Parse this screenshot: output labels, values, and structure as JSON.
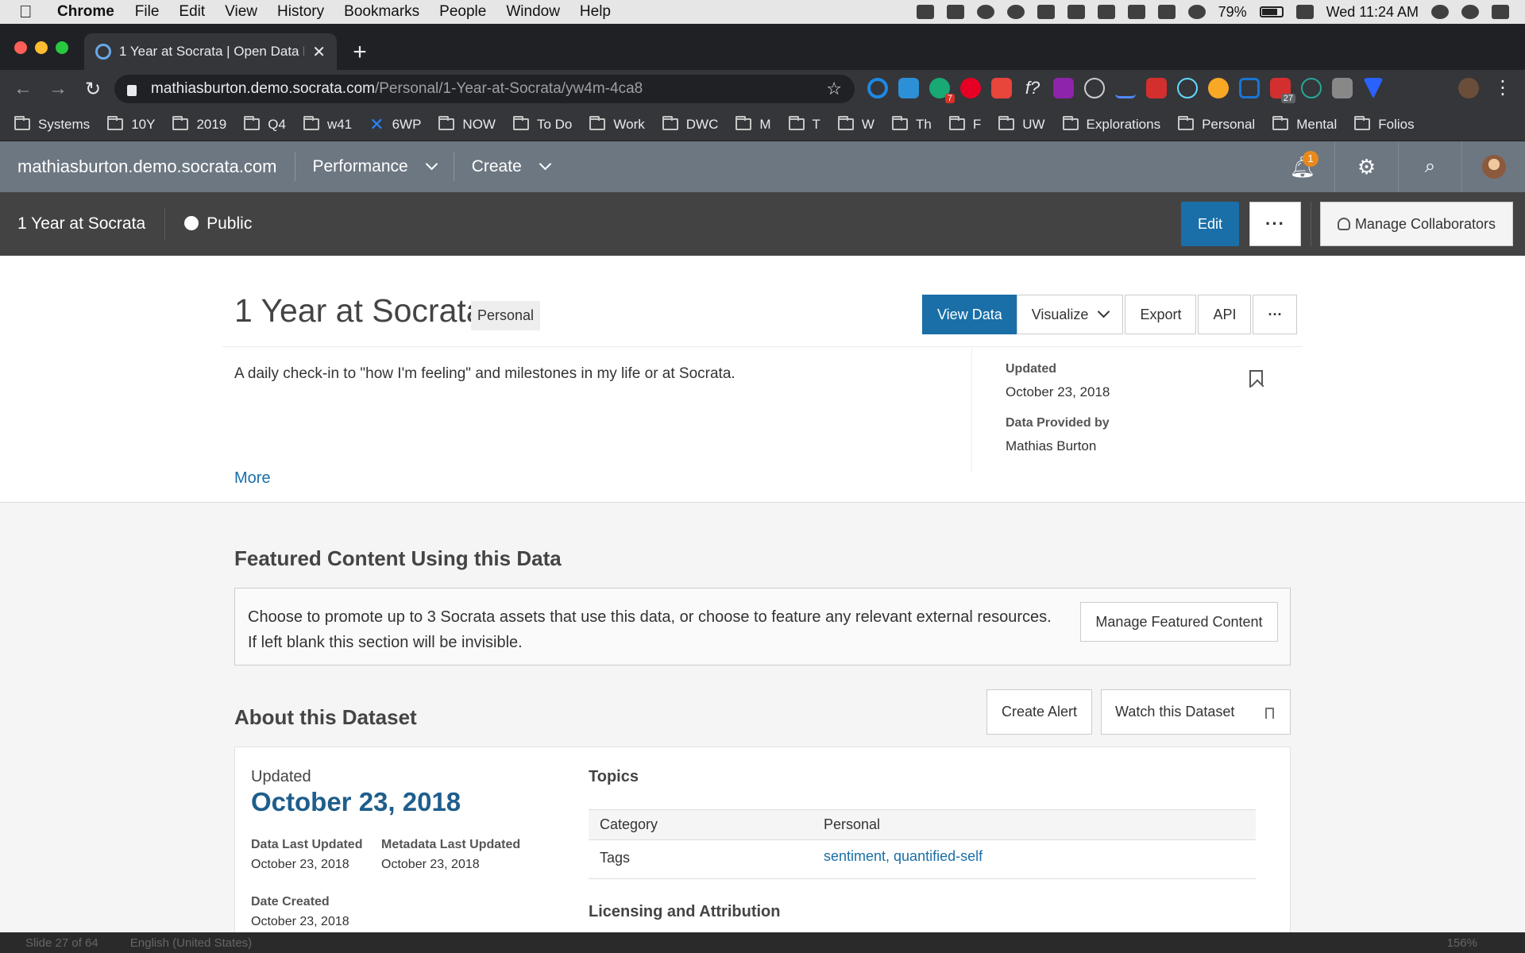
{
  "os_menu": {
    "app": "Chrome",
    "items": [
      "File",
      "Edit",
      "View",
      "History",
      "Bookmarks",
      "People",
      "Window",
      "Help"
    ],
    "battery": "79%",
    "clock": "Wed 11:24 AM"
  },
  "browser": {
    "tab_title": "1 Year at Socrata | Open Data P",
    "url_host": "mathiasburton.demo.socrata.com",
    "url_path": "/Personal/1-Year-at-Socrata/yw4m-4ca8",
    "bookmarks": [
      "Systems",
      "10Y",
      "2019",
      "Q4",
      "w41",
      "6WP",
      "NOW",
      "To Do",
      "Work",
      "DWC",
      "M",
      "T",
      "W",
      "Th",
      "F",
      "UW",
      "Explorations",
      "Personal",
      "Mental",
      "Folios"
    ],
    "extension_badges": {
      "ext3": "7",
      "ext15": "27"
    }
  },
  "site_header": {
    "site_name": "mathiasburton.demo.socrata.com",
    "nav": [
      "Performance",
      "Create"
    ],
    "notification_count": "1"
  },
  "asset_bar": {
    "name": "1 Year at Socrata",
    "visibility": "Public",
    "edit_label": "Edit",
    "more_label": "···",
    "collab_label": "Manage Collaborators"
  },
  "hero": {
    "title": "1 Year at Socrata",
    "category_tag": "Personal",
    "actions": [
      "View Data",
      "Visualize",
      "Export",
      "API",
      "···"
    ],
    "description": "A daily check-in to \"how I'm feeling\" and milestones in my life or at Socrata.",
    "more_label": "More",
    "updated_label": "Updated",
    "updated_value": "October 23, 2018",
    "provided_label": "Data Provided by",
    "provided_value": "Mathias Burton"
  },
  "featured": {
    "title": "Featured Content Using this Data",
    "text": "Choose to promote up to 3 Socrata assets that use this data, or choose to feature any relevant external resources. If left blank this section will be invisible.",
    "button": "Manage Featured Content"
  },
  "about": {
    "title": "About this Dataset",
    "create_alert": "Create Alert",
    "watch": "Watch this Dataset",
    "updated_label": "Updated",
    "updated_big": "October 23, 2018",
    "data_last_updated_label": "Data Last Updated",
    "data_last_updated": "October 23, 2018",
    "metadata_last_updated_label": "Metadata Last Updated",
    "metadata_last_updated": "October 23, 2018",
    "date_created_label": "Date Created",
    "date_created": "October 23, 2018",
    "topics_title": "Topics",
    "rows": [
      {
        "key": "Category",
        "value": "Personal"
      },
      {
        "key": "Tags",
        "value": "sentiment, quantified-self"
      }
    ],
    "licensing_title": "Licensing and Attribution"
  },
  "bottom_strip": {
    "slide": "Slide 27 of 64",
    "language": "English (United States)",
    "zoom": "156%"
  },
  "colors": {
    "primary_blue": "#1a6fa8",
    "site_header": "#6d7782",
    "asset_bar": "#434343",
    "badge": "#e8891d"
  }
}
